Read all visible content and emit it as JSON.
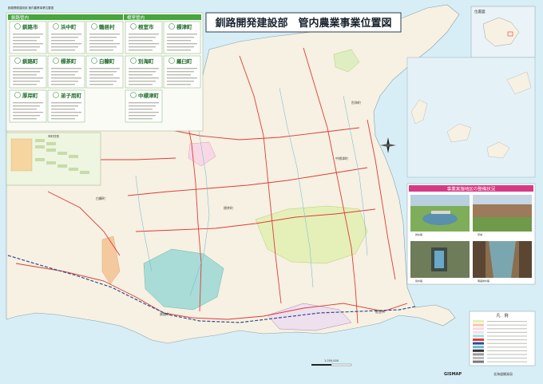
{
  "header_small": "釧路開発建設部 管内農業事業位置図",
  "title": "釧路開発建設部　管内農業事業位置図",
  "panels": {
    "kushiro_label": "釧路管内",
    "nemuro_label": "根室管内",
    "kushiro_towns": [
      "釧路市",
      "浜中町",
      "鶴居村",
      "釧路町",
      "標茶町",
      "白糠町",
      "厚岸町",
      "弟子屈町"
    ],
    "nemuro_towns": [
      "根室市",
      "標津町",
      "別海町",
      "羅臼町",
      "中標津町"
    ]
  },
  "photo_header": "事業実施地区の整備状況",
  "photo_captions": [
    "",
    "",
    "",
    ""
  ],
  "inset_label": "位置図",
  "legend_title": "凡　例",
  "footer_left": "GISMAP",
  "footer_right": "北海道開発局",
  "scale_label": "1:250,000",
  "colors": {
    "sea": "#d6eef6",
    "land": "#f7f2e4",
    "green_area": "#dfeeb2",
    "pond": "#a8dcd8",
    "road": "#e03a3a",
    "railway": "#2b4f8f",
    "header_green": "#47a43f",
    "photo_header": "#d63a84"
  }
}
